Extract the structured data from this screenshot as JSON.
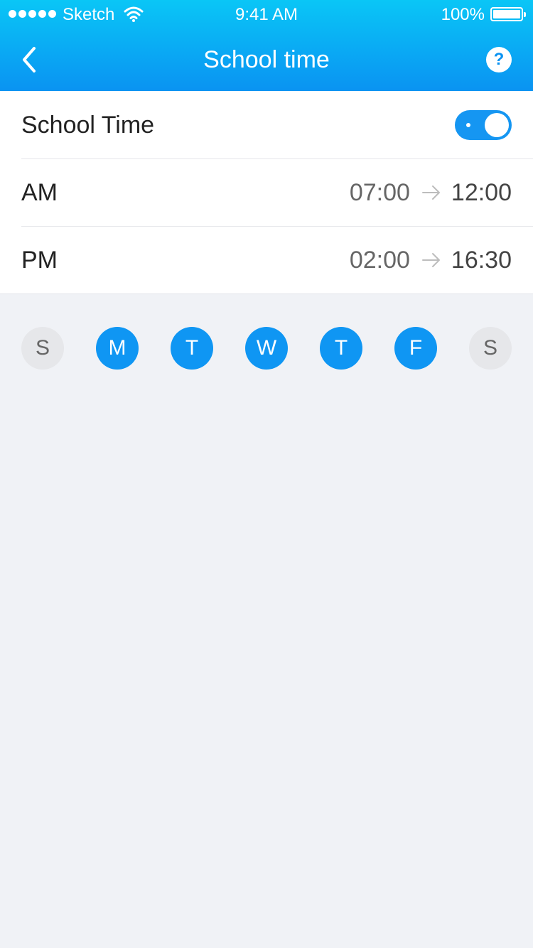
{
  "status_bar": {
    "carrier": "Sketch",
    "time": "9:41 AM",
    "battery": "100%"
  },
  "nav": {
    "title": "School time",
    "back_icon": "chevron-left-icon",
    "help_icon": "question-circle-icon",
    "help_label": "?"
  },
  "school_time": {
    "label": "School Time",
    "enabled": true
  },
  "periods": [
    {
      "label": "AM",
      "start": "07:00",
      "end": "12:00"
    },
    {
      "label": "PM",
      "start": "02:00",
      "end": "16:30"
    }
  ],
  "days": [
    {
      "label": "S",
      "selected": false
    },
    {
      "label": "M",
      "selected": true
    },
    {
      "label": "T",
      "selected": true
    },
    {
      "label": "W",
      "selected": true
    },
    {
      "label": "T",
      "selected": true
    },
    {
      "label": "F",
      "selected": true
    },
    {
      "label": "S",
      "selected": false
    }
  ],
  "colors": {
    "accent": "#0f96f3",
    "header_top": "#0ac6f6",
    "header_bottom": "#0a93f2",
    "day_off": "#e6e7ea",
    "background": "#f0f2f6"
  }
}
